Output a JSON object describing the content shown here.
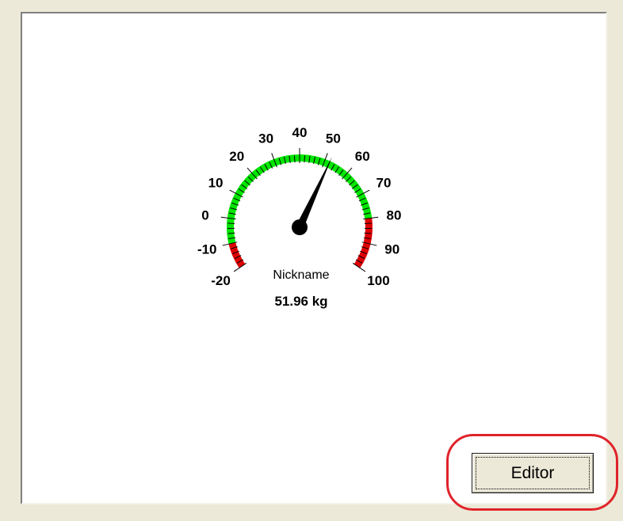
{
  "gauge": {
    "ticks": [
      "-20",
      "-10",
      "0",
      "10",
      "20",
      "30",
      "40",
      "50",
      "60",
      "70",
      "80",
      "90",
      "100"
    ],
    "min": -20,
    "max": 100,
    "green_range": [
      -10,
      80
    ],
    "red_ranges": [
      [
        -20,
        -10
      ],
      [
        80,
        100
      ]
    ],
    "value": 51.96,
    "caption": "Nickname",
    "value_text": "51.96 kg",
    "colors": {
      "green": "#00E600",
      "red": "#E00000",
      "needle": "#000000"
    }
  },
  "editor_button": {
    "label": "Editor"
  },
  "highlight": {
    "color": "#E0232A"
  }
}
